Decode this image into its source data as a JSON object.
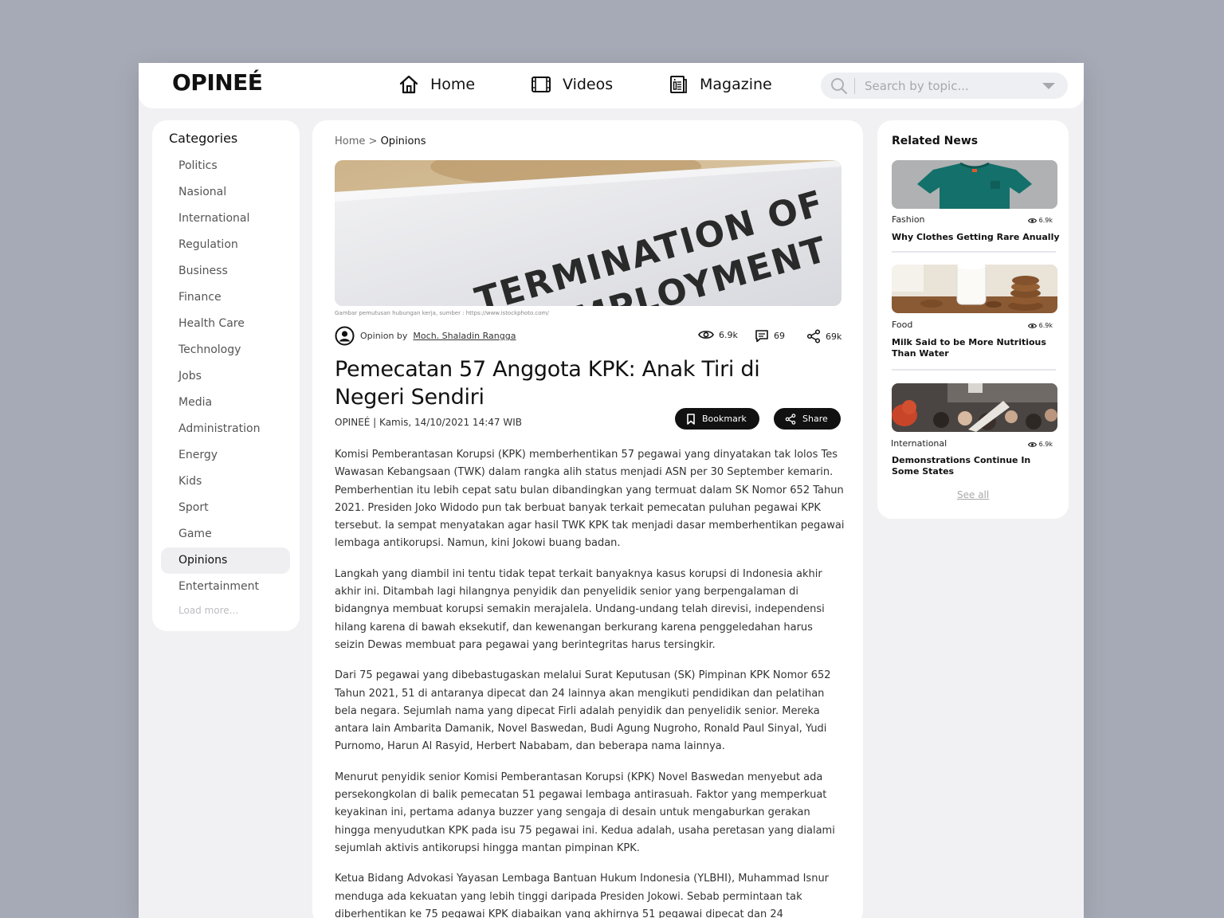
{
  "brand": {
    "logo": "OPINEÉ"
  },
  "nav": {
    "items": [
      {
        "label": "Home",
        "icon": "home-icon"
      },
      {
        "label": "Videos",
        "icon": "video-icon"
      },
      {
        "label": "Magazine",
        "icon": "magazine-icon"
      }
    ]
  },
  "search": {
    "placeholder": "Search by topic..."
  },
  "categories": {
    "title": "Categories",
    "items": [
      "Politics",
      "Nasional",
      "International",
      "Regulation",
      "Business",
      "Finance",
      "Health Care",
      "Technology",
      "Jobs",
      "Media",
      "Administration",
      "Energy",
      "Kids",
      "Sport",
      "Game",
      "Opinions",
      "Entertainment"
    ],
    "active": "Opinions",
    "load_more": "Load more..."
  },
  "article": {
    "breadcrumb": {
      "home": "Home",
      "sep": ">",
      "current": "Opinions"
    },
    "hero_text": [
      "TERMINATION OF",
      "EMPLOYMENT"
    ],
    "caption": "Gambar pemutusan hubungan kerja, sumber : https://www.istockphoto.com/",
    "byline_prefix": "Opinion by",
    "author": "Moch. Shaladin Rangga",
    "views": "6.9k",
    "comments": "69",
    "shares": "69k",
    "title": "Pemecatan 57 Anggota KPK: Anak Tiri di Negeri Sendiri",
    "meta": "OPINEÉ | Kamis, 14/10/2021 14:47 WIB",
    "bookmark_label": "Bookmark",
    "share_label": "Share",
    "paragraphs": [
      "Komisi Pemberantasan Korupsi (KPK) memberhentikan 57 pegawai yang dinyatakan tak lolos Tes Wawasan Kebangsaan (TWK) dalam rangka alih status menjadi ASN per 30 September kemarin. Pemberhentian itu lebih cepat satu bulan dibandingkan yang termuat dalam SK Nomor 652 Tahun 2021. Presiden Joko Widodo pun tak berbuat banyak terkait pemecatan puluhan pegawai KPK tersebut. Ia sempat menyatakan agar hasil TWK KPK tak menjadi dasar memberhentikan pegawai lembaga antikorupsi. Namun, kini Jokowi buang badan.",
      "Langkah yang diambil ini tentu tidak tepat terkait banyaknya kasus korupsi di Indonesia akhir akhir ini. Ditambah lagi hilangnya penyidik dan penyelidik senior yang berpengalaman di bidangnya membuat korupsi semakin merajalela. Undang-undang telah direvisi, independensi hilang karena di bawah eksekutif, dan kewenangan berkurang karena penggeledahan harus seizin Dewas membuat para pegawai yang berintegritas harus tersingkir.",
      "Dari 75 pegawai yang dibebastugaskan melalui Surat Keputusan (SK) Pimpinan KPK Nomor 652 Tahun 2021, 51 di antaranya dipecat dan 24 lainnya akan mengikuti pendidikan dan pelatihan bela negara. Sejumlah nama yang dipecat Firli adalah penyidik dan penyelidik senior. Mereka antara lain Ambarita Damanik, Novel Baswedan, Budi Agung Nugroho, Ronald Paul Sinyal, Yudi Purnomo, Harun Al Rasyid, Herbert Nababam, dan beberapa nama lainnya.",
      "Menurut penyidik senior Komisi Pemberantasan Korupsi (KPK) Novel Baswedan menyebut ada persekongkolan di balik pemecatan 51 pegawai lembaga antirasuah. Faktor yang memperkuat keyakinan ini, pertama adanya buzzer yang sengaja di desain untuk mengaburkan gerakan hingga menyudutkan KPK pada isu 75 pegawai ini. Kedua adalah, usaha peretasan yang dialami sejumlah aktivis antikorupsi hingga mantan pimpinan KPK.",
      "Ketua Bidang Advokasi Yayasan Lembaga Bantuan Hukum Indonesia (YLBHI), Muhammad Isnur menduga ada kekuatan yang lebih tinggi daripada Presiden Jokowi. Sebab permintaan tak diberhentikan ke 75 pegawai KPK diabaikan yang akhirnya 51 pegawai dipecat dan 24"
    ]
  },
  "related": {
    "title": "Related News",
    "items": [
      {
        "category": "Fashion",
        "views": "6.9k",
        "title": "Why Clothes Getting Rare Anually",
        "image": "green-tshirt"
      },
      {
        "category": "Food",
        "views": "6.9k",
        "title": "Milk Said to be More Nutritious Than Water",
        "image": "milk-and-cookies"
      },
      {
        "category": "International",
        "views": "6.9k",
        "title": "Demonstrations Continue In Some States",
        "image": "crowd-protest"
      }
    ],
    "see_all": "See all"
  }
}
